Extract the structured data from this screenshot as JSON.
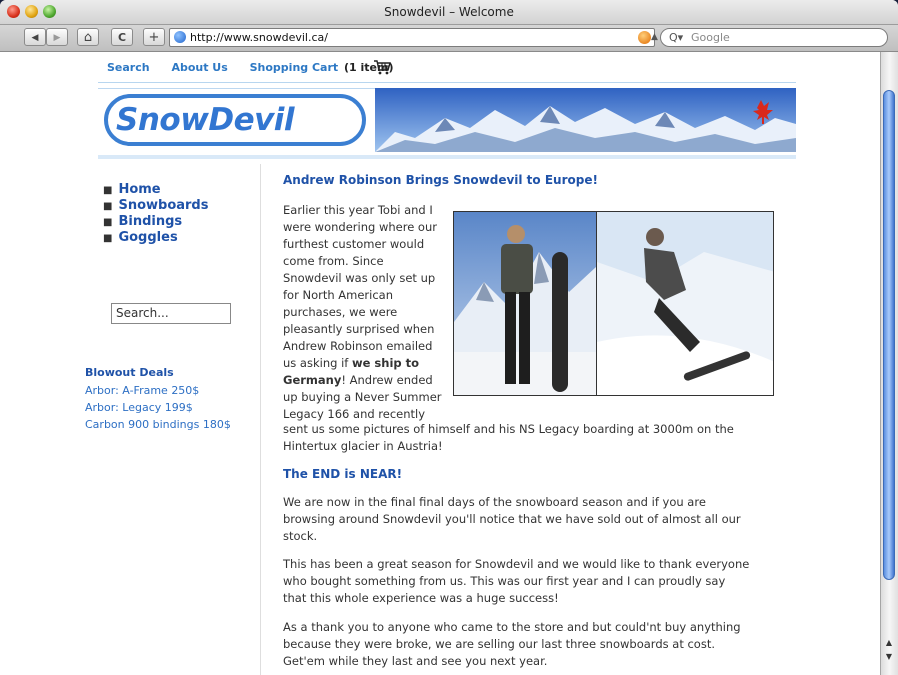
{
  "window": {
    "title": "Snowdevil – Welcome"
  },
  "browser": {
    "url": "http://www.snowdevil.ca/",
    "search_placeholder": "Google",
    "back_label": "◀",
    "forward_label": "▶",
    "home_label": "⌂",
    "reload_label": "C",
    "add_label": "+"
  },
  "site": {
    "logo_text": "SnowDevil",
    "topnav": {
      "search": "Search",
      "about": "About Us",
      "cart": "Shopping Cart",
      "cart_count": "(1 item)"
    },
    "sidebar": {
      "items": [
        {
          "label": "Home"
        },
        {
          "label": "Snowboards"
        },
        {
          "label": "Bindings"
        },
        {
          "label": "Goggles"
        }
      ],
      "search_placeholder": "Search...",
      "deals_title": "Blowout Deals",
      "deals": [
        {
          "label": "Arbor: A-Frame 250$"
        },
        {
          "label": "Arbor: Legacy 199$"
        },
        {
          "label": "Carbon 900 bindings 180$"
        }
      ]
    },
    "articles": [
      {
        "title": "Andrew Robinson Brings Snowdevil to Europe!",
        "lines": [
          "Earlier this year Tobi and I",
          "were wondering where our",
          "furthest customer would",
          "come from. Since",
          "Snowdevil was only set up",
          "for North American",
          "purchases, we were",
          "pleasantly surprised when",
          "Andrew Robinson emailed",
          "us asking if",
          "we ship to",
          "Germany",
          "! Andrew ended",
          "up buying a Never Summer",
          "Legacy 166 and recently"
        ],
        "wide_lines": [
          "sent us some pictures of himself and his NS Legacy boarding at 3000m on the",
          "Hintertux glacier in Austria!"
        ]
      },
      {
        "title": "The END is NEAR!",
        "paragraphs": [
          [
            "We are now in the final final days of the snowboard season and if you are",
            "browsing around Snowdevil you'll notice that we have sold out of almost all our",
            "stock."
          ],
          [
            "This has been a great season for Snowdevil and we would like to thank everyone",
            "who bought something from us. This was our first year and I can proudly say",
            "that this whole experience was a huge success!"
          ],
          [
            "As a thank you to anyone who came to the store and but could'nt buy anything",
            "because they were broke, we are selling our last three snowboards at cost.",
            "Get'em while they last and see you next year."
          ]
        ]
      }
    ]
  },
  "colors": {
    "link": "#2d78c4",
    "heading": "#1f52a8",
    "logo": "#3276d1"
  }
}
